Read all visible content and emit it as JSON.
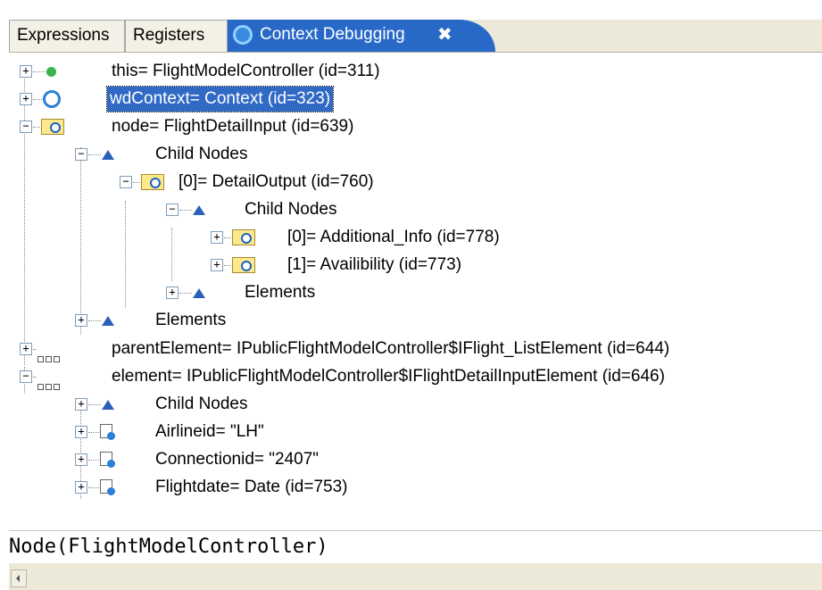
{
  "tabs": {
    "expressions": "Expressions",
    "registers": "Registers",
    "context_debugging": "Context Debugging",
    "close_glyph": "✖"
  },
  "tree": [
    {
      "text": "this= FlightModelController  (id=311)",
      "icon": "green-dot-icon",
      "expander": "+"
    },
    {
      "text": "wdContext= Context  (id=323)",
      "icon": "context-circle-icon",
      "expander": "+",
      "selected": true
    },
    {
      "text": "node= FlightDetailInput  (id=639)",
      "icon": "node-folder-icon",
      "expander": "−"
    },
    {
      "text": "Child Nodes",
      "icon": "child-nodes-triangle-icon",
      "expander": "−"
    },
    {
      "text": "[0]= DetailOutput  (id=760)",
      "icon": "node-folder-icon",
      "expander": "−"
    },
    {
      "text": "Child Nodes",
      "icon": "child-nodes-triangle-icon",
      "expander": "−"
    },
    {
      "text": "[0]= Additional_Info  (id=778)",
      "icon": "node-folder-icon",
      "expander": "+"
    },
    {
      "text": "[1]= Availibility  (id=773)",
      "icon": "node-folder-icon",
      "expander": "+"
    },
    {
      "text": "Elements",
      "icon": "elements-triangle-icon",
      "expander": "+"
    },
    {
      "text": "Elements",
      "icon": "elements-triangle-icon",
      "expander": "+"
    },
    {
      "text": "parentElement= IPublicFlightModelController$IFlight_ListElement  (id=644)",
      "icon": "element-dots-icon",
      "expander": "+"
    },
    {
      "text": "element= IPublicFlightModelController$IFlightDetailInputElement  (id=646)",
      "icon": "element-dots-icon",
      "expander": "−"
    },
    {
      "text": "Child Nodes",
      "icon": "child-nodes-triangle-icon",
      "expander": "+"
    },
    {
      "text": "Airlineid= \"LH\"",
      "icon": "attribute-icon",
      "expander": "+"
    },
    {
      "text": "Connectionid= \"2407\"",
      "icon": "attribute-icon",
      "expander": "+"
    },
    {
      "text": "Flightdate= Date  (id=753)",
      "icon": "attribute-icon",
      "expander": "+"
    }
  ],
  "status_line": "Node(FlightModelController)",
  "colors": {
    "active_tab": "#2869c8",
    "selection": "#316ac5",
    "tab_strip": "#ece9d8"
  }
}
